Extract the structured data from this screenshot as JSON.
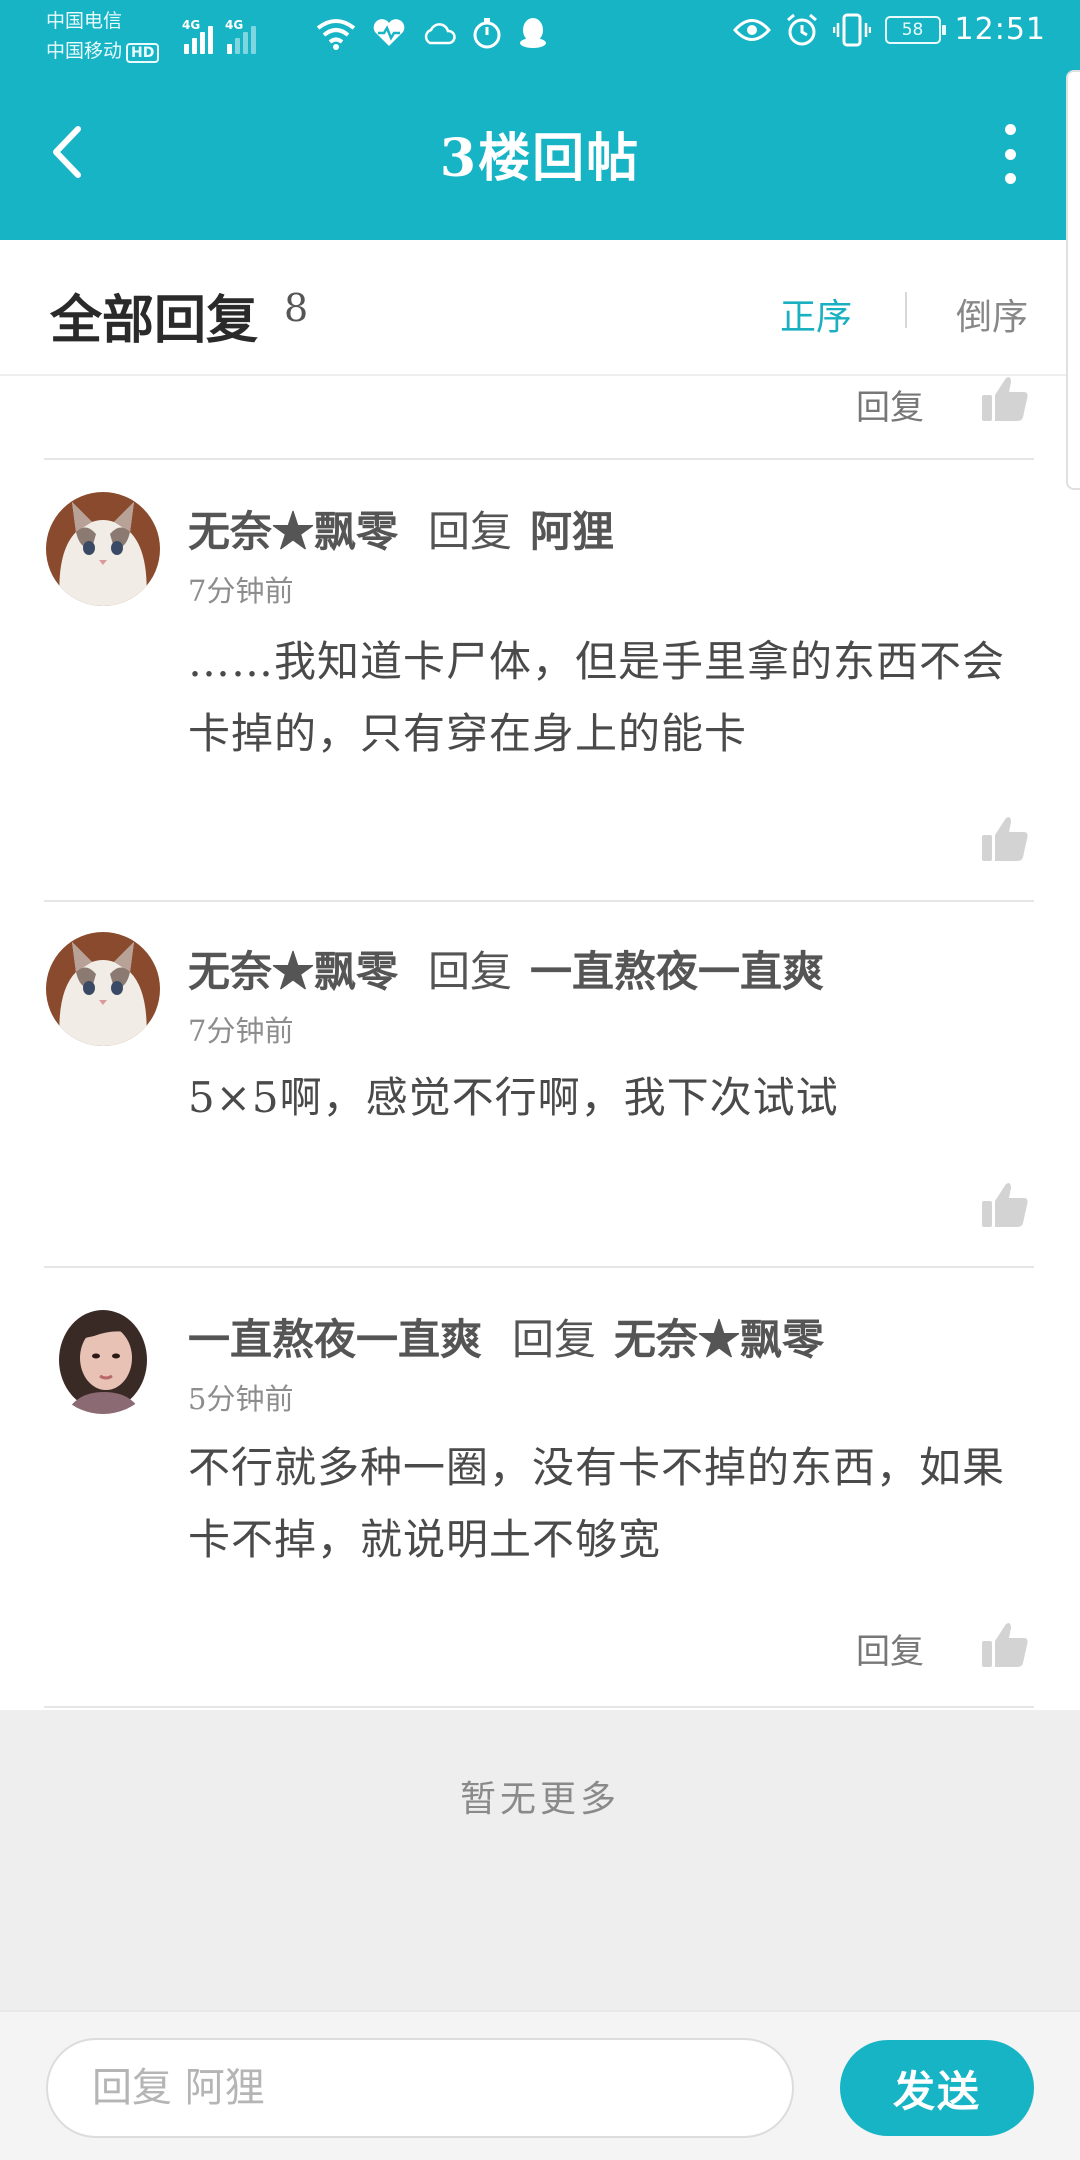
{
  "status_bar": {
    "carrier_1": "中国电信",
    "carrier_2": "中国移动",
    "hd_badge": "HD",
    "network_1": "4G",
    "network_2": "4G",
    "battery": "58",
    "time": "12:51"
  },
  "header": {
    "title": "3楼回帖",
    "accent_color": "#17b4c6"
  },
  "reply_header": {
    "title": "全部回复",
    "count": "8",
    "sort_asc": "正序",
    "sort_desc": "倒序"
  },
  "partial_row": {
    "reply_label": "回复"
  },
  "replies": [
    {
      "user": "无奈★飘零",
      "verb": "回复",
      "target": "阿狸",
      "time": "7分钟前",
      "content": "……我知道卡尸体，但是手里拿的东西不会卡掉的，只有穿在身上的能卡",
      "avatar": "cat-avatar",
      "reply_label": ""
    },
    {
      "user": "无奈★飘零",
      "verb": "回复",
      "target": "一直熬夜一直爽",
      "time": "7分钟前",
      "content": "5×5啊，感觉不行啊，我下次试试",
      "avatar": "cat-avatar",
      "reply_label": ""
    },
    {
      "user": "一直熬夜一直爽",
      "verb": "回复",
      "target": "无奈★飘零",
      "time": "5分钟前",
      "content": "不行就多种一圈，没有卡不掉的东西，如果卡不掉，就说明土不够宽",
      "avatar": "woman-avatar",
      "reply_label": "回复"
    }
  ],
  "footer": {
    "no_more": "暂无更多"
  },
  "input_bar": {
    "placeholder": "回复 阿狸",
    "send_label": "发送"
  }
}
